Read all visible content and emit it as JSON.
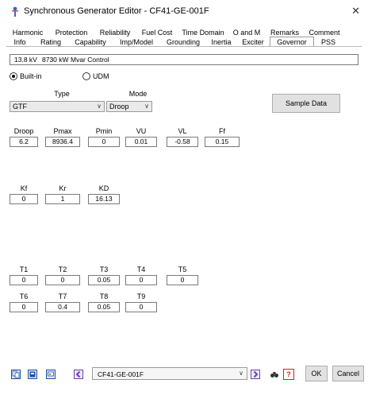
{
  "window": {
    "title": "Synchronous Generator Editor - CF41-GE-001F",
    "close_glyph": "✕"
  },
  "tabs_top": [
    "Harmonic",
    "Protection",
    "Reliability",
    "Fuel Cost",
    "Time Domain",
    "O and M",
    "Remarks",
    "Comment"
  ],
  "tabs_bottom": [
    "Info",
    "Rating",
    "Capability",
    "Imp/Model",
    "Grounding",
    "Inertia",
    "Exciter",
    "Governor",
    "PSS"
  ],
  "active_tab": "Governor",
  "info_bar": {
    "kv": "13.8 kV",
    "kw": "8730 kW",
    "mode": "Mvar Control"
  },
  "radios": {
    "builtin": "Built-in",
    "udm": "UDM"
  },
  "type": {
    "label": "Type",
    "value": "GTF"
  },
  "mode": {
    "label": "Mode",
    "value": "Droop"
  },
  "sample_data_button": "Sample Data",
  "params_row1": [
    {
      "label": "Droop",
      "value": "6.2"
    },
    {
      "label": "Pmax",
      "value": "8936.4"
    },
    {
      "label": "Pmin",
      "value": "0"
    },
    {
      "label": "VU",
      "value": "0.01"
    },
    {
      "label": "VL",
      "value": "-0.58"
    },
    {
      "label": "Ff",
      "value": "0.15"
    }
  ],
  "params_row2": [
    {
      "label": "Kf",
      "value": "0"
    },
    {
      "label": "Kr",
      "value": "1"
    },
    {
      "label": "KD",
      "value": "16.13"
    }
  ],
  "params_row3": [
    {
      "label": "T1",
      "value": "0"
    },
    {
      "label": "T2",
      "value": "0"
    },
    {
      "label": "T3",
      "value": "0.05"
    },
    {
      "label": "T4",
      "value": "0"
    },
    {
      "label": "T5",
      "value": "0"
    }
  ],
  "params_row4": [
    {
      "label": "T6",
      "value": "0"
    },
    {
      "label": "T7",
      "value": "0.4"
    },
    {
      "label": "T8",
      "value": "0.05"
    },
    {
      "label": "T9",
      "value": "0"
    }
  ],
  "footer": {
    "selector_value": "CF41-GE-001F",
    "ok": "OK",
    "cancel": "Cancel",
    "help_glyph": "?"
  },
  "colors": {
    "accent": "#1e4fa8",
    "help_red": "#d42020",
    "nav_purple": "#6a3fb5"
  }
}
